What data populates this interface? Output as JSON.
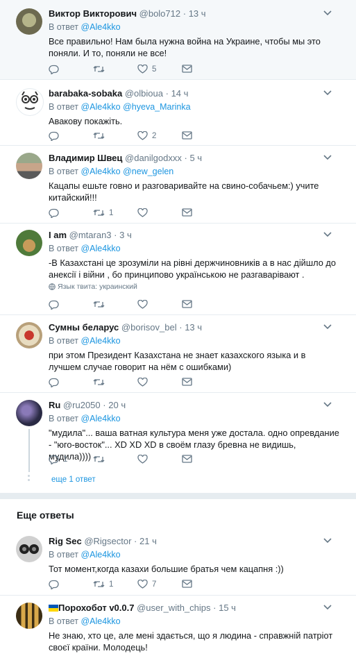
{
  "tweets": [
    {
      "name": "Виктор Викторович",
      "handle": "@bolo712",
      "time": "13 ч",
      "reply_label": "В ответ",
      "reply_to": "@Ale4kko",
      "text": "Все правильно! Нам была нужна война на Украине, чтобы мы это поняли. И то, поняли не все!",
      "retweets": "",
      "likes": "5",
      "avatar_colors": [
        "#6d6a50",
        "#b5b48a"
      ]
    },
    {
      "name": "barabaka-sobaka",
      "handle": "@olbioua",
      "time": "14 ч",
      "reply_label": "В ответ",
      "reply_to": "@Ale4kko @hyeva_Marinka",
      "text": "Авакову покажіть.",
      "retweets": "",
      "likes": "2",
      "avatar_colors": [
        "#ffffff",
        "#333333"
      ]
    },
    {
      "name": "Владимир Швец",
      "handle": "@danilgodxxx",
      "time": "5 ч",
      "reply_label": "В ответ",
      "reply_to": "@Ale4kko @new_gelen",
      "text": "Кацапы ешьте говно и разговаривайте на свино-собачьем:) учите китайский!!!",
      "retweets": "1",
      "likes": "",
      "avatar_colors": [
        "#7c8c6a",
        "#c7a58a"
      ]
    },
    {
      "name": "I am",
      "handle": "@mtaran3",
      "time": "3 ч",
      "reply_label": "В ответ",
      "reply_to": "@Ale4kko",
      "text": "-В Казахстані це зрозуміли на рівні держчиновників а в нас дійшло до анексії і війни , бо принципово українською не разгаварівают .",
      "lang": "Язык твита: украинский",
      "retweets": "",
      "likes": "",
      "avatar_colors": [
        "#4f7a3a",
        "#c79b5a"
      ]
    },
    {
      "name": "Сумны беларус",
      "handle": "@borisov_bel",
      "time": "13 ч",
      "reply_label": "В ответ",
      "reply_to": "@Ale4kko",
      "text": "при этом Президент Казахстана не знает казахского языка и в лучшем случае говорит на нём с ошибками)",
      "retweets": "",
      "likes": "",
      "avatar_colors": [
        "#b8a07a",
        "#c8372d"
      ]
    },
    {
      "name": "Ru",
      "handle": "@ru2050",
      "time": "20 ч",
      "reply_label": "В ответ",
      "reply_to": "@Ale4kko",
      "text": "\"мудила\"... ваша ватная культура меня уже достала. одно опревдание - \"юго-восток\"... XD XD XD в своём глазу бревна не видишь, мудила))))",
      "replies": "1",
      "retweets": "",
      "likes": "",
      "avatar_colors": [
        "#2a2a44",
        "#8a7ab8"
      ]
    },
    {
      "name": "Rig Sec",
      "handle": "@Rigsector",
      "time": "21 ч",
      "reply_label": "В ответ",
      "reply_to": "@Ale4kko",
      "text": "Тот момент,когда казахи большие братья чем кацапня :))",
      "retweets": "1",
      "likes": "7",
      "avatar_colors": [
        "#d0d0d0",
        "#222222"
      ]
    },
    {
      "name": "Порохобот v0.0.7",
      "handle": "@user_with_chips",
      "time": "15 ч",
      "reply_label": "В ответ",
      "reply_to": "@Ale4kko",
      "text": "Не знаю, хто це, але мені здається, що я людина - справжній патріот своєї країни. Молодець!",
      "retweets": "",
      "likes": "",
      "avatar_colors": [
        "#3b2d14",
        "#d8a84a"
      ]
    }
  ],
  "show_more": "еще 1 ответ",
  "more_replies_title": "Еще ответы",
  "colors": {
    "link": "#1b95e0",
    "muted": "#657786",
    "flag_blue": "#0057b7",
    "flag_yellow": "#ffd700"
  }
}
